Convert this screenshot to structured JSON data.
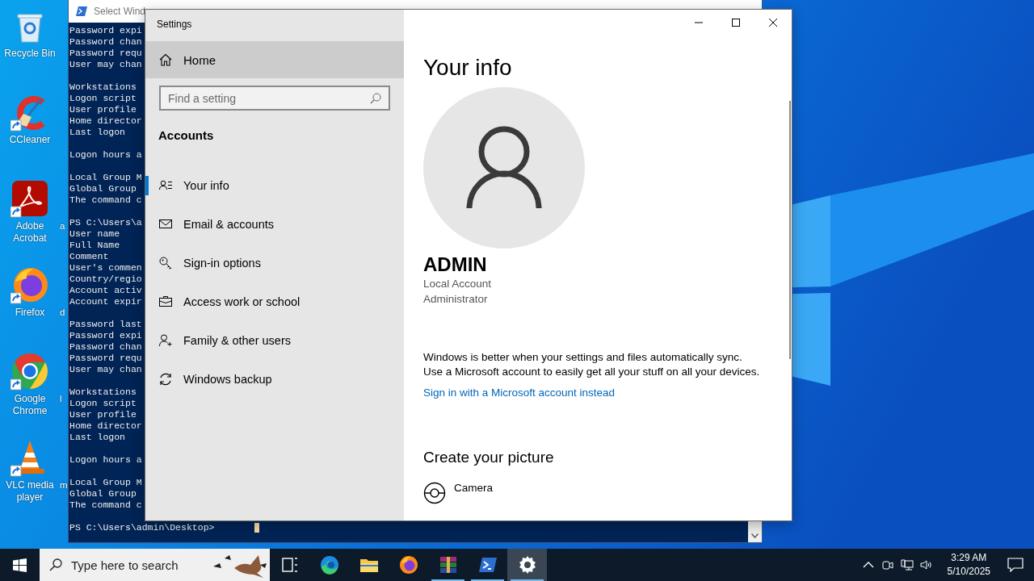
{
  "desktop": {
    "icons": [
      {
        "label": "Recycle Bin",
        "kind": "recycle"
      },
      {
        "label": "CCleaner",
        "kind": "ccleaner"
      },
      {
        "label": "Adobe Acrobat",
        "kind": "acrobat"
      },
      {
        "label": "Firefox",
        "kind": "firefox"
      },
      {
        "label": "Google Chrome",
        "kind": "chrome"
      },
      {
        "label": "VLC media player",
        "kind": "vlc"
      }
    ],
    "partial_labels": [
      "a",
      "d",
      "l",
      "m"
    ]
  },
  "terminal": {
    "title": "Select Wind",
    "blocks": [
      [
        "Password expi",
        "Password chan",
        "Password requ",
        "User may chan"
      ],
      [
        "Workstations",
        "Logon script",
        "User profile",
        "Home director",
        "Last logon"
      ],
      [
        "Logon hours a"
      ],
      [
        "Local Group M",
        "Global Group",
        "The command c"
      ],
      [
        "PS C:\\Users\\a",
        "User name",
        "Full Name",
        "Comment",
        "User's commen",
        "Country/regio",
        "Account activ",
        "Account expir"
      ],
      [
        "Password last",
        "Password expi",
        "Password chan",
        "Password requ",
        "User may chan"
      ],
      [
        "Workstations",
        "Logon script",
        "User profile",
        "Home director",
        "Last logon"
      ],
      [
        "Logon hours a"
      ],
      [
        "Local Group M",
        "Global Group",
        "The command c"
      ],
      [
        "PS C:\\Users\\admin\\Desktop>"
      ]
    ]
  },
  "settings": {
    "title": "Settings",
    "home": "Home",
    "search": {
      "placeholder": "Find a setting"
    },
    "section": "Accounts",
    "nav": [
      {
        "label": "Your info",
        "kind": "person-list",
        "selected": true
      },
      {
        "label": "Email & accounts",
        "kind": "mail",
        "selected": false
      },
      {
        "label": "Sign-in options",
        "kind": "key",
        "selected": false
      },
      {
        "label": "Access work or school",
        "kind": "briefcase",
        "selected": false
      },
      {
        "label": "Family & other users",
        "kind": "person-add",
        "selected": false
      },
      {
        "label": "Windows backup",
        "kind": "sync",
        "selected": false
      }
    ],
    "page_title": "Your info",
    "user_name": "ADMIN",
    "account_type": "Local Account",
    "role": "Administrator",
    "sync_lines": [
      "Windows is better when your settings and files automatically sync.",
      "Use a Microsoft account to easily get all your stuff on all your devices."
    ],
    "link": "Sign in with a Microsoft account instead",
    "picture_heading": "Create your picture",
    "picture_options": [
      {
        "label": "Camera",
        "kind": "camera"
      }
    ]
  },
  "taskbar": {
    "search": {
      "placeholder": "Type here to search"
    },
    "apps": [
      {
        "kind": "taskview",
        "running": false,
        "selected": false
      },
      {
        "kind": "edge",
        "running": false,
        "selected": false
      },
      {
        "kind": "explorer",
        "running": false,
        "selected": false
      },
      {
        "kind": "firefox",
        "running": false,
        "selected": false
      },
      {
        "kind": "winrar",
        "running": true,
        "selected": false
      },
      {
        "kind": "powershell",
        "running": true,
        "selected": false
      },
      {
        "kind": "settings",
        "running": true,
        "selected": true
      }
    ],
    "clock": {
      "time": "3:29 AM",
      "date": "5/10/2025"
    }
  }
}
